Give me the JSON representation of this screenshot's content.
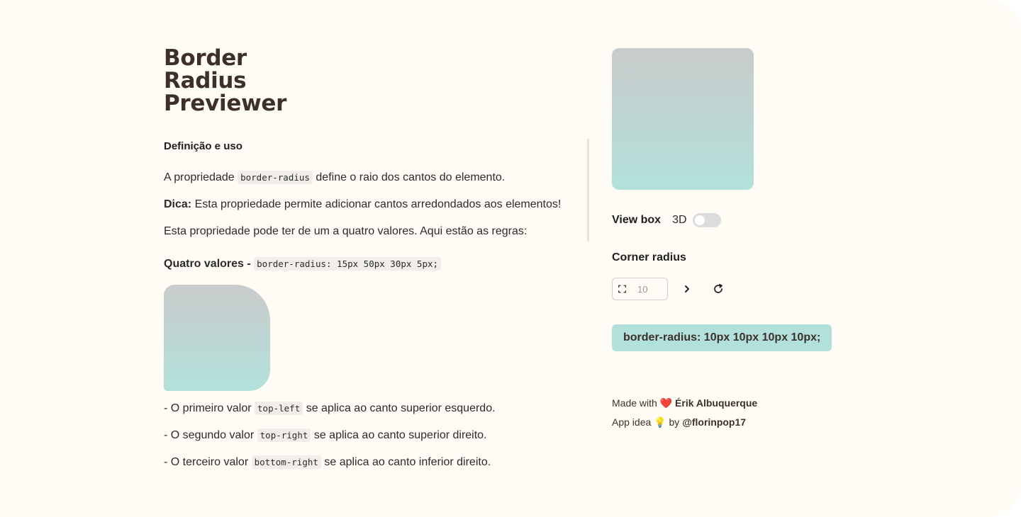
{
  "title_lines": [
    "Border",
    "Radius",
    "Previewer"
  ],
  "definition": {
    "heading": "Definição e uso",
    "p1": {
      "before": "A propriedade",
      "code": "border-radius",
      "after": "define o raio dos cantos do elemento."
    },
    "p2": {
      "bold": "Dica:",
      "text": "Esta propriedade permite adicionar cantos arredondados aos elementos!"
    },
    "p3": "Esta propriedade pode ter de um a quatro valores. Aqui estão as regras:",
    "four_values": {
      "label": "Quatro valores -",
      "code": "border-radius: 15px 50px 30px 5px;"
    },
    "rules": [
      {
        "before": "- O primeiro valor",
        "code": "top-left",
        "after": "se aplica ao canto superior esquerdo."
      },
      {
        "before": "- O segundo valor",
        "code": "top-right",
        "after": "se aplica ao canto superior direito."
      },
      {
        "before": "- O terceiro valor",
        "code": "bottom-right",
        "after": "se aplica ao canto inferior direito."
      }
    ]
  },
  "controls": {
    "view_box_label": "View box",
    "three_d_label": "3D",
    "three_d_enabled": false,
    "corner_radius_label": "Corner radius",
    "radius_placeholder": "10",
    "icons": {
      "frame": "frame-corners-icon",
      "next": "chevron-right-icon",
      "reset": "refresh-icon"
    }
  },
  "css_output": "border-radius: 10px 10px 10px 10px;",
  "credits": {
    "made_with": "Made with",
    "heart": "❤️",
    "author": "Érik Albuquerque",
    "app_idea": "App idea",
    "bulb": "💡",
    "by": "by",
    "idea_author": "@florinpop17"
  },
  "colors": {
    "background": "#fffbf5",
    "accent": "#b2e1db",
    "gradient_top": "#c9cbcb",
    "heading": "#3d302b"
  }
}
